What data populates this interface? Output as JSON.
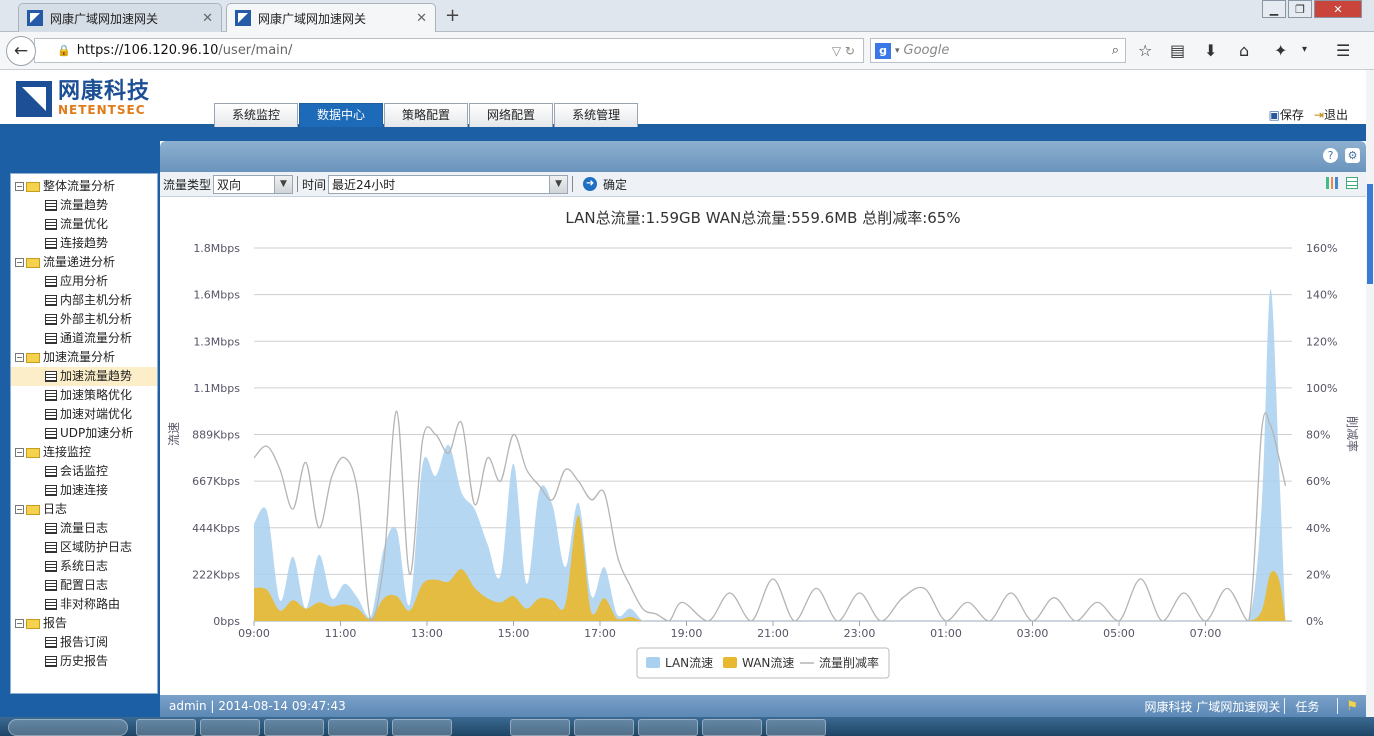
{
  "browser": {
    "tabs": [
      {
        "title": "网康广域网加速网关",
        "active": false
      },
      {
        "title": "网康广域网加速网关",
        "active": true
      }
    ],
    "new_tab_icon": "plus-icon",
    "window_controls": [
      "minimize",
      "maximize",
      "close"
    ],
    "url": "https://106.120.96.10/user/main/",
    "url_host": "https://106.120.96.10",
    "url_path": "/user/main/",
    "search_placeholder": "Google"
  },
  "app": {
    "logo_cn": "网康科技",
    "logo_en": "NETENTSEC",
    "nav_tabs": [
      "系统监控",
      "数据中心",
      "策略配置",
      "网络配置",
      "系统管理"
    ],
    "active_nav": "数据中心",
    "actions": {
      "save": "保存",
      "logout": "退出"
    }
  },
  "sidebar": {
    "groups": [
      {
        "label": "整体流量分析",
        "items": [
          "流量趋势",
          "流量优化",
          "连接趋势"
        ]
      },
      {
        "label": "流量递进分析",
        "items": [
          "应用分析",
          "内部主机分析",
          "外部主机分析",
          "通道流量分析"
        ]
      },
      {
        "label": "加速流量分析",
        "items": [
          "加速流量趋势",
          "加速策略优化",
          "加速对端优化",
          "UDP加速分析"
        ]
      },
      {
        "label": "连接监控",
        "items": [
          "会话监控",
          "加速连接"
        ]
      },
      {
        "label": "日志",
        "items": [
          "流量日志",
          "区域防护日志",
          "系统日志",
          "配置日志",
          "非对称路由"
        ]
      },
      {
        "label": "报告",
        "items": [
          "报告订阅",
          "历史报告"
        ]
      }
    ],
    "selected": "加速流量趋势"
  },
  "toolbar": {
    "flow_type_label": "流量类型",
    "flow_type_value": "双向",
    "time_label": "时间",
    "time_value": "最近24小时",
    "confirm": "确定"
  },
  "chart_data": {
    "type": "area",
    "title": "LAN总流量:1.59GB WAN总流量:559.6MB 总削减率:65%",
    "ylabel": "流速",
    "y2label": "削减率",
    "y_ticks": [
      "0bps",
      "222Kbps",
      "444Kbps",
      "667Kbps",
      "889Kbps",
      "1.1Mbps",
      "1.3Mbps",
      "1.6Mbps",
      "1.8Mbps"
    ],
    "y2_ticks": [
      "0%",
      "20%",
      "40%",
      "60%",
      "80%",
      "100%",
      "120%",
      "140%",
      "160%"
    ],
    "x_ticks": [
      "09:00",
      "11:00",
      "13:00",
      "15:00",
      "17:00",
      "19:00",
      "21:00",
      "23:00",
      "01:00",
      "03:00",
      "05:00",
      "07:00"
    ],
    "ymax_kbps": 1800,
    "y2max": 160,
    "x_hours_from_0900": [
      0,
      0.3,
      0.6,
      0.9,
      1.2,
      1.5,
      1.8,
      2.1,
      2.4,
      2.7,
      3,
      3.3,
      3.6,
      3.9,
      4.2,
      4.5,
      4.8,
      5.1,
      5.4,
      5.7,
      6,
      6.3,
      6.6,
      6.9,
      7.2,
      7.5,
      7.8,
      8.1,
      8.4,
      8.7,
      9,
      9.3,
      9.6,
      9.9,
      10.5,
      11,
      11.5,
      12,
      12.5,
      13,
      13.5,
      14,
      14.5,
      15,
      15.5,
      16,
      16.5,
      17,
      17.5,
      18,
      18.5,
      19,
      19.5,
      20,
      20.5,
      21,
      21.5,
      22,
      22.5,
      23,
      23.3,
      23.5,
      23.7,
      23.85
    ],
    "series": [
      {
        "name": "LAN流速",
        "color": "#a9d0ef",
        "values": [
          470,
          530,
          100,
          310,
          60,
          320,
          110,
          180,
          110,
          20,
          350,
          440,
          80,
          760,
          700,
          850,
          620,
          540,
          370,
          220,
          760,
          180,
          630,
          560,
          260,
          570,
          120,
          260,
          30,
          60,
          0,
          0,
          0,
          0,
          0,
          0,
          0,
          0,
          0,
          0,
          0,
          0,
          0,
          0,
          0,
          0,
          0,
          0,
          0,
          0,
          0,
          0,
          0,
          0,
          0,
          0,
          0,
          0,
          0,
          0,
          560,
          1600,
          750,
          0
        ]
      },
      {
        "name": "WAN流速",
        "color": "#e8b92e",
        "values": [
          160,
          150,
          50,
          100,
          60,
          90,
          70,
          80,
          60,
          10,
          110,
          120,
          50,
          180,
          200,
          190,
          250,
          160,
          110,
          90,
          120,
          60,
          110,
          100,
          80,
          510,
          40,
          110,
          10,
          20,
          0,
          0,
          0,
          0,
          0,
          0,
          0,
          0,
          0,
          0,
          0,
          0,
          0,
          0,
          0,
          0,
          0,
          0,
          0,
          0,
          0,
          0,
          0,
          0,
          0,
          0,
          0,
          0,
          0,
          0,
          50,
          230,
          200,
          0
        ]
      },
      {
        "name": "流量削减率",
        "color": "#b4b4b4",
        "values": [
          70,
          75,
          65,
          48,
          68,
          40,
          62,
          70,
          55,
          0,
          25,
          90,
          20,
          78,
          80,
          72,
          85,
          50,
          70,
          60,
          80,
          65,
          58,
          52,
          65,
          60,
          52,
          55,
          28,
          15,
          5,
          3,
          0,
          8,
          0,
          12,
          0,
          18,
          0,
          14,
          0,
          12,
          0,
          10,
          14,
          0,
          8,
          0,
          12,
          0,
          10,
          0,
          8,
          0,
          18,
          0,
          12,
          0,
          14,
          0,
          82,
          84,
          70,
          58
        ]
      }
    ],
    "legend": [
      "LAN流速",
      "WAN流速",
      "流量削减率"
    ]
  },
  "footer": {
    "user_time": "admin | 2014-08-14 09:47:43",
    "product": "网康科技 广域网加速网关",
    "tasks": "任务"
  }
}
